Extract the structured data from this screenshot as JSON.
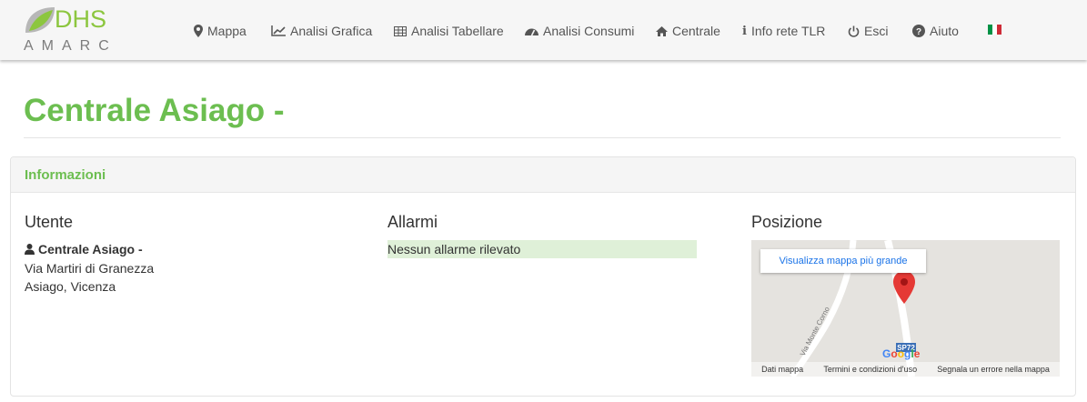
{
  "brand": {
    "name": "DHS",
    "sub": "AMARC"
  },
  "nav": {
    "items": [
      {
        "label": "Mappa",
        "icon": "map-marker-icon"
      },
      {
        "label": "Analisi Grafica",
        "icon": "line-chart-icon"
      },
      {
        "label": "Analisi Tabellare",
        "icon": "table-icon"
      },
      {
        "label": "Analisi Consumi",
        "icon": "dashboard-icon"
      },
      {
        "label": "Centrale",
        "icon": "home-icon"
      },
      {
        "label": "Info rete TLR",
        "icon": "info-icon"
      },
      {
        "label": "Esci",
        "icon": "power-icon"
      },
      {
        "label": "Aiuto",
        "icon": "question-circle-icon"
      }
    ],
    "language_flag": "italy-flag-icon"
  },
  "page": {
    "title": "Centrale Asiago -"
  },
  "panel": {
    "title": "Informazioni"
  },
  "user": {
    "heading": "Utente",
    "name": "Centrale Asiago -",
    "address_line1": "Via Martiri di Granezza",
    "address_line2": "Asiago, Vicenza"
  },
  "alarms": {
    "heading": "Allarmi",
    "status": "Nessun allarme rilevato"
  },
  "position": {
    "heading": "Posizione",
    "map_button": "Visualizza mappa più grande",
    "road_label": "SP72",
    "street_label": "Via Monte Corno",
    "footer": {
      "data": "Dati mappa",
      "terms": "Termini e condizioni d'uso",
      "report": "Segnala un errore nella mappa"
    }
  },
  "colors": {
    "accent": "#6cbe50",
    "alarm_ok_bg": "#dff0d8",
    "flag": [
      "#009246",
      "#ffffff",
      "#ce2b37"
    ]
  }
}
